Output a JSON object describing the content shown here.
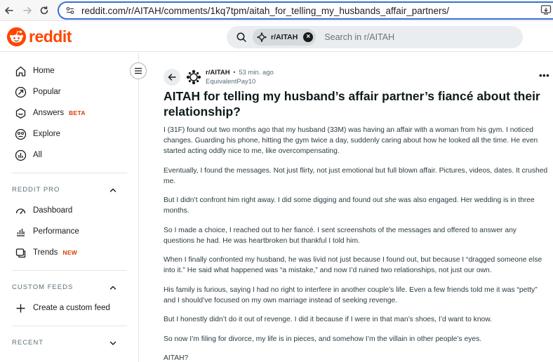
{
  "browser": {
    "url": "reddit.com/r/AITAH/comments/1kq7tpm/aitah_for_telling_my_husbands_affair_partners/"
  },
  "header": {
    "logo_text": "reddit",
    "search": {
      "chip_label": "r/AITAH",
      "placeholder": "Search in r/AITAH"
    },
    "brand_color": "#ff4500"
  },
  "sidebar": {
    "items": [
      {
        "label": "Home",
        "icon": "home-icon"
      },
      {
        "label": "Popular",
        "icon": "popular-icon"
      },
      {
        "label": "Answers",
        "icon": "answers-icon",
        "badge": "BETA"
      },
      {
        "label": "Explore",
        "icon": "explore-icon"
      },
      {
        "label": "All",
        "icon": "all-icon"
      }
    ],
    "reddit_pro": {
      "title": "REDDIT PRO",
      "items": [
        {
          "label": "Dashboard",
          "icon": "dashboard-icon"
        },
        {
          "label": "Performance",
          "icon": "performance-icon"
        },
        {
          "label": "Trends",
          "icon": "trends-icon",
          "badge": "NEW"
        }
      ]
    },
    "custom_feeds": {
      "title": "CUSTOM FEEDS",
      "items": [
        {
          "label": "Create a custom feed",
          "icon": "plus-icon"
        }
      ]
    },
    "recent": {
      "title": "RECENT"
    }
  },
  "post": {
    "subreddit": "r/AITAH",
    "separator": "•",
    "time": "53 min. ago",
    "author": "EquivalentPay10",
    "more": "•••",
    "title": "AITAH for telling my husband’s affair partner’s fiancé about their relationship?",
    "body": {
      "p1": "I (31F) found out two months ago that my husband (33M) was having an affair with a woman from his gym. I noticed changes. Guarding his phone, hitting the gym twice a day, suddenly caring about how he looked all the time. He even started acting oddly nice to me, like overcompensating.",
      "p2": "Eventually, I found the messages. Not just flirty, not just emotional but full blown affair. Pictures, videos, dates. It crushed me.",
      "p3_before": "But I didn’t confront him right away. I did some digging and found out ",
      "p3_em": "she",
      "p3_after": " was also engaged. Her wedding is in three months.",
      "p4": "So I made a choice, I reached out to her fiancé. I sent screenshots of the messages and offered to answer any questions he had. He was heartbroken but thankful I told him.",
      "p5": "When I finally confronted my husband, he was livid not just because I found out, but because I “dragged someone else into it.” He said what happened was “a mistake,” and now I’d ruined two relationships, not just our own.",
      "p6": "His family is furious, saying I had no right to interfere in another couple’s life. Even a few friends told me it was “petty” and I should’ve focused on my own marriage instead of seeking revenge.",
      "p7": "But I honestly didn’t do it out of revenge. I did it because if I were in that man’s shoes, I’d want to know.",
      "p8": "So now I’m filing for divorce, my life is in pieces, and somehow I’m the villain in other people’s eyes.",
      "p9": "AITAH?"
    }
  }
}
